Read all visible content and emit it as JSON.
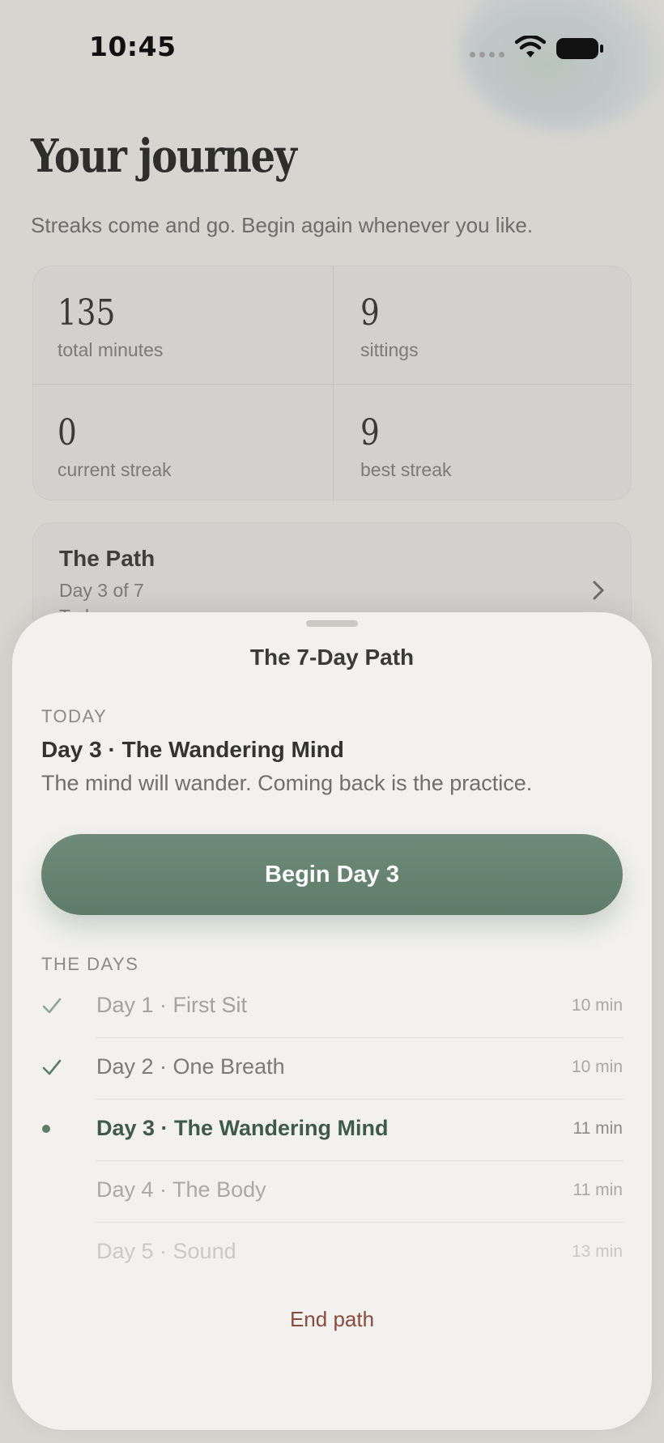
{
  "status_bar": {
    "time": "10:45"
  },
  "journey": {
    "title": "Your journey",
    "subtitle": "Streaks come and go. Begin again whenever you like.",
    "stats": [
      {
        "value": "135",
        "label": "total minutes"
      },
      {
        "value": "9",
        "label": "sittings"
      },
      {
        "value": "0",
        "label": "current streak"
      },
      {
        "value": "9",
        "label": "best streak"
      }
    ],
    "path_card": {
      "title": "The Path",
      "subtitle": "Day 3 of 7",
      "extra": "Today"
    }
  },
  "sheet": {
    "title": "The 7-Day Path",
    "today_label": "TODAY",
    "today_title": "Day 3 · The Wandering Mind",
    "today_desc": "The mind will wander. Coming back is the practice.",
    "begin_label": "Begin Day 3",
    "days_label": "THE DAYS",
    "days": [
      {
        "name": "Day 1 · First Sit",
        "duration": "10 min",
        "state": "done"
      },
      {
        "name": "Day 2 · One Breath",
        "duration": "10 min",
        "state": "done"
      },
      {
        "name": "Day 3 · The Wandering Mind",
        "duration": "11 min",
        "state": "current"
      },
      {
        "name": "Day 4 · The Body",
        "duration": "11 min",
        "state": "upcoming"
      },
      {
        "name": "Day 5 · Sound",
        "duration": "13 min",
        "state": "upcoming"
      }
    ],
    "end_label": "End path"
  },
  "colors": {
    "accent": "#627f6c",
    "destructive": "#8a4a40",
    "sheet_bg": "#f2f1ed"
  }
}
